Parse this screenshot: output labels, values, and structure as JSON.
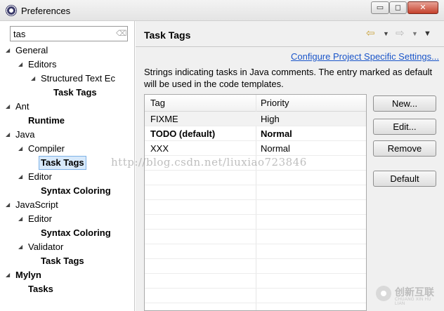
{
  "window": {
    "title": "Preferences",
    "minimize": "▭",
    "maximize": "◻",
    "close": "✕"
  },
  "filter": {
    "value": "tas"
  },
  "tree": [
    {
      "label": "General",
      "level": 0,
      "twisty": "◢"
    },
    {
      "label": "Editors",
      "level": 1,
      "twisty": "◢"
    },
    {
      "label": "Structured Text Ec",
      "level": 2,
      "twisty": "◢"
    },
    {
      "label": "Task Tags",
      "level": 3,
      "bold": true
    },
    {
      "label": "Ant",
      "level": 0,
      "twisty": "◢"
    },
    {
      "label": "Runtime",
      "level": 1,
      "bold": true
    },
    {
      "label": "Java",
      "level": 0,
      "twisty": "◢"
    },
    {
      "label": "Compiler",
      "level": 1,
      "twisty": "◢"
    },
    {
      "label": "Task Tags",
      "level": 2,
      "bold": true,
      "selected": true
    },
    {
      "label": "Editor",
      "level": 1,
      "twisty": "◢"
    },
    {
      "label": "Syntax Coloring",
      "level": 2,
      "bold": true
    },
    {
      "label": "JavaScript",
      "level": 0,
      "twisty": "◢"
    },
    {
      "label": "Editor",
      "level": 1,
      "twisty": "◢"
    },
    {
      "label": "Syntax Coloring",
      "level": 2,
      "bold": true
    },
    {
      "label": "Validator",
      "level": 1,
      "twisty": "◢"
    },
    {
      "label": "Task Tags",
      "level": 2,
      "bold": true
    },
    {
      "label": "Mylyn",
      "level": 0,
      "twisty": "◢",
      "bold": true
    },
    {
      "label": "Tasks",
      "level": 1,
      "bold": true
    }
  ],
  "page": {
    "title": "Task Tags",
    "configure_link": "Configure Project Specific Settings...",
    "description": "Strings indicating tasks in Java comments. The entry marked as default will be used in the code templates."
  },
  "nav": {
    "back": "⇦",
    "back_dd": "▼",
    "forward": "⇨",
    "forward_dd": "▼",
    "menu": "▼"
  },
  "table": {
    "headers": [
      "Tag",
      "Priority"
    ],
    "rows": [
      {
        "tag": "FIXME",
        "priority": "High"
      },
      {
        "tag": "TODO (default)",
        "priority": "Normal",
        "bold": true
      },
      {
        "tag": "XXX",
        "priority": "Normal"
      }
    ]
  },
  "buttons": {
    "new": "New...",
    "edit": "Edit...",
    "remove": "Remove",
    "default": "Default"
  },
  "watermark": {
    "text": "http://blog.csdn.net/liuxiao723846"
  },
  "logo": {
    "cn": "创新互联",
    "en": "CHUANG XIN HU LIAN"
  },
  "colors": {
    "link": "#1a55c9",
    "selection": "#d7e9fb",
    "nav_arrow": "#c9a23c"
  }
}
